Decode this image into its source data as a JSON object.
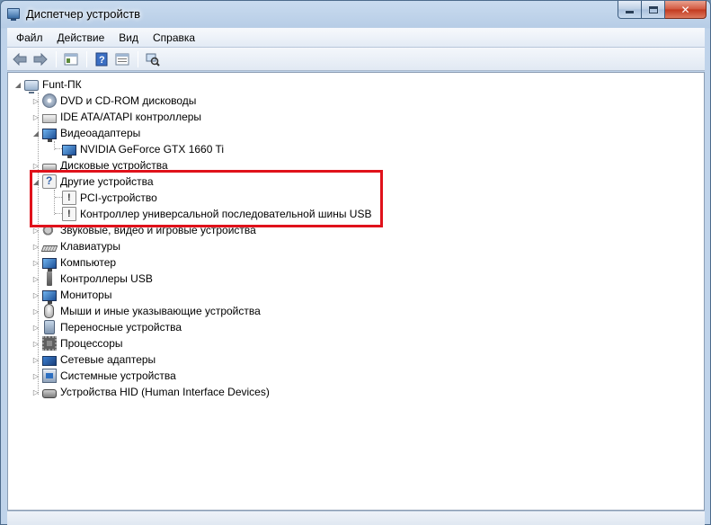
{
  "window": {
    "title": "Диспетчер устройств"
  },
  "menu": [
    "Файл",
    "Действие",
    "Вид",
    "Справка"
  ],
  "toolbar": {
    "icons": [
      "back-arrow-icon",
      "forward-arrow-icon",
      "properties-icon",
      "help-icon",
      "console-tree-icon",
      "scan-hardware-icon"
    ]
  },
  "tree": {
    "root": "Funt-ПК",
    "items": [
      {
        "label": "DVD и CD-ROM дисководы",
        "icon": "dvd-drive-icon"
      },
      {
        "label": "IDE ATA/ATAPI контроллеры",
        "icon": "ide-controller-icon"
      },
      {
        "label": "Видеоадаптеры",
        "icon": "display-adapter-icon",
        "expanded": true,
        "children": [
          {
            "label": "NVIDIA GeForce GTX 1660 Ti",
            "icon": "monitor-icon"
          }
        ]
      },
      {
        "label": "Дисковые устройства",
        "icon": "disk-drive-icon"
      },
      {
        "label": "Другие устройства",
        "icon": "unknown-device-icon",
        "expanded": true,
        "children": [
          {
            "label": "PCI-устройство",
            "icon": "warning-device-icon"
          },
          {
            "label": "Контроллер универсальной последовательной шины USB",
            "icon": "warning-device-icon"
          }
        ]
      },
      {
        "label": "Звуковые, видео и игровые устройства",
        "icon": "sound-icon"
      },
      {
        "label": "Клавиатуры",
        "icon": "keyboard-icon"
      },
      {
        "label": "Компьютер",
        "icon": "computer-icon"
      },
      {
        "label": "Контроллеры USB",
        "icon": "usb-icon"
      },
      {
        "label": "Мониторы",
        "icon": "monitor-icon"
      },
      {
        "label": "Мыши и иные указывающие устройства",
        "icon": "mouse-icon"
      },
      {
        "label": "Переносные устройства",
        "icon": "portable-device-icon"
      },
      {
        "label": "Процессоры",
        "icon": "cpu-icon"
      },
      {
        "label": "Сетевые адаптеры",
        "icon": "network-adapter-icon"
      },
      {
        "label": "Системные устройства",
        "icon": "system-device-icon"
      },
      {
        "label": "Устройства HID (Human Interface Devices)",
        "icon": "hid-icon"
      }
    ]
  },
  "colors": {
    "highlight": "#e0121b",
    "title_bar": "#c9dbef",
    "content_bg": "#ffffff"
  }
}
